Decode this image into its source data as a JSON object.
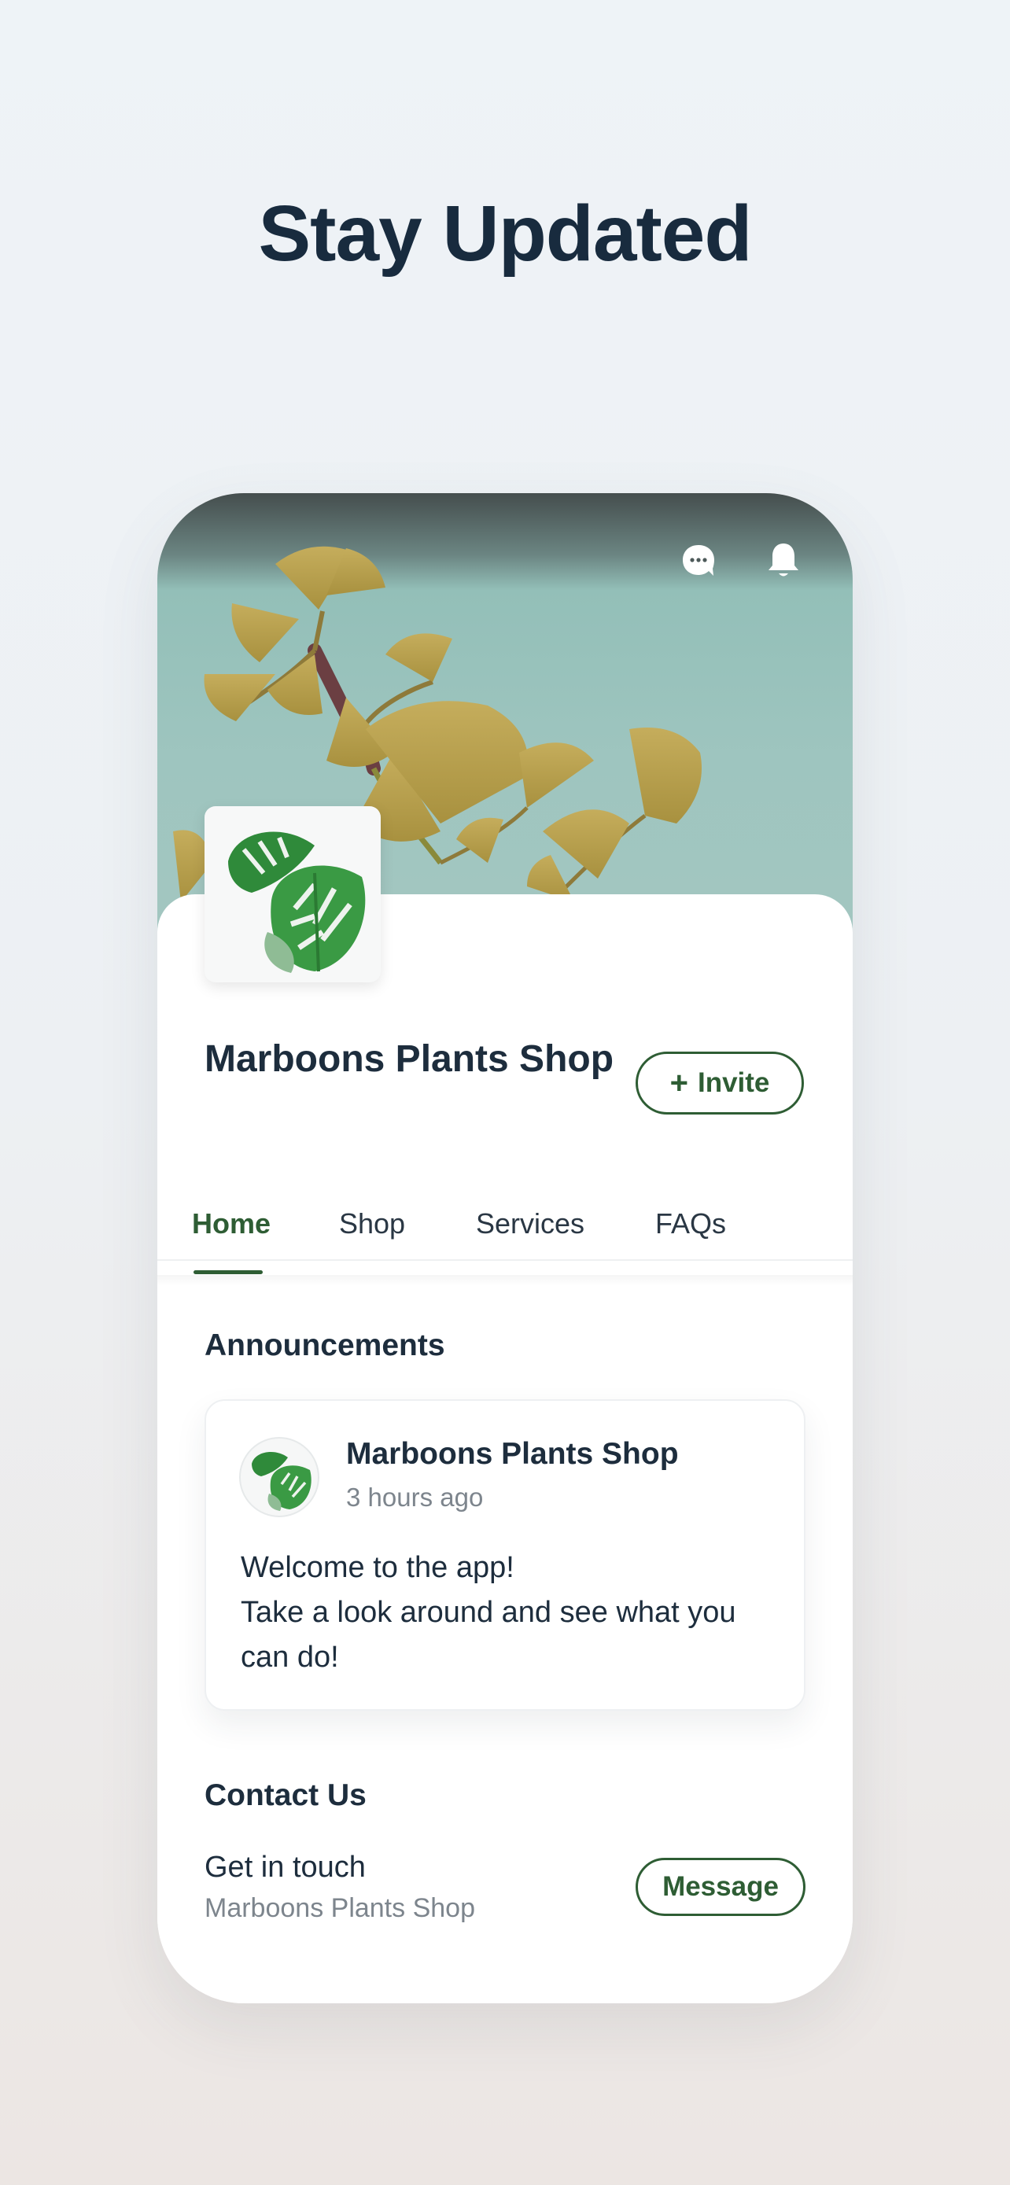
{
  "headline": "Stay Updated",
  "header": {
    "icons": [
      "chat-bubble-icon",
      "bell-icon"
    ]
  },
  "profile": {
    "name": "Marboons Plants Shop",
    "invite_label": "Invite",
    "invite_icon": "plus-icon"
  },
  "tabs": [
    {
      "label": "Home",
      "active": true
    },
    {
      "label": "Shop",
      "active": false
    },
    {
      "label": "Services",
      "active": false
    },
    {
      "label": "FAQs",
      "active": false
    }
  ],
  "announcements": {
    "title": "Announcements",
    "post": {
      "author": "Marboons Plants Shop",
      "time": "3 hours ago",
      "lines": [
        "Welcome to the app!",
        "Take a look around and see what you",
        "can do!"
      ]
    }
  },
  "contact": {
    "title": "Contact Us",
    "label": "Get in touch",
    "sub": "Marboons Plants Shop",
    "button_label": "Message"
  },
  "colors": {
    "accent": "#2e5d34",
    "heading": "#182b3e",
    "muted": "#7d858d"
  }
}
